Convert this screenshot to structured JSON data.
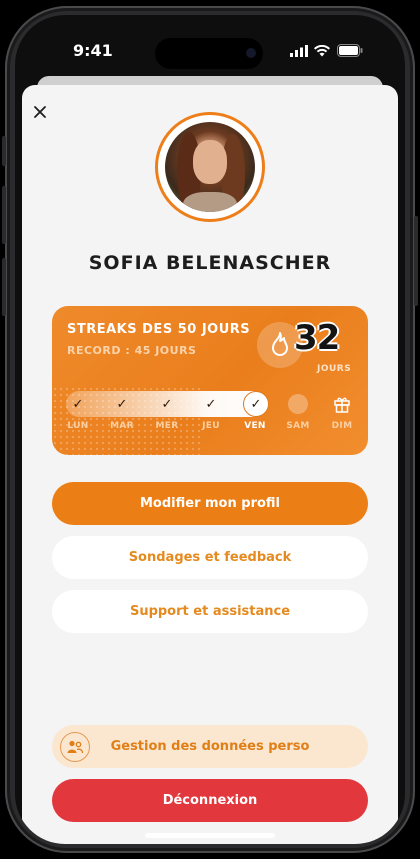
{
  "status_bar": {
    "time": "9:41"
  },
  "profile": {
    "name": "SOFIA BELENASCHER"
  },
  "streak": {
    "title": "STREAKS DES 50 JOURS",
    "record": "RECORD :  45 JOURS",
    "count": "32",
    "count_unit": "JOURS",
    "days": [
      {
        "label": "LUN",
        "state": "done"
      },
      {
        "label": "MAR",
        "state": "done"
      },
      {
        "label": "MER",
        "state": "done"
      },
      {
        "label": "JEU",
        "state": "done"
      },
      {
        "label": "VEN",
        "state": "today"
      },
      {
        "label": "SAM",
        "state": "future"
      },
      {
        "label": "DIM",
        "state": "reward"
      }
    ],
    "colors": {
      "card": "#ea7e1c",
      "today_text": "#ffffff"
    }
  },
  "buttons": {
    "edit_profile": "Modifier mon profil",
    "surveys": "Sondages et feedback",
    "support": "Support et assistance",
    "personal_data": "Gestion des données perso",
    "logout": "Déconnexion"
  },
  "colors": {
    "accent": "#eb7f16",
    "danger": "#e2373c",
    "sheet": "#f4f4f4"
  }
}
